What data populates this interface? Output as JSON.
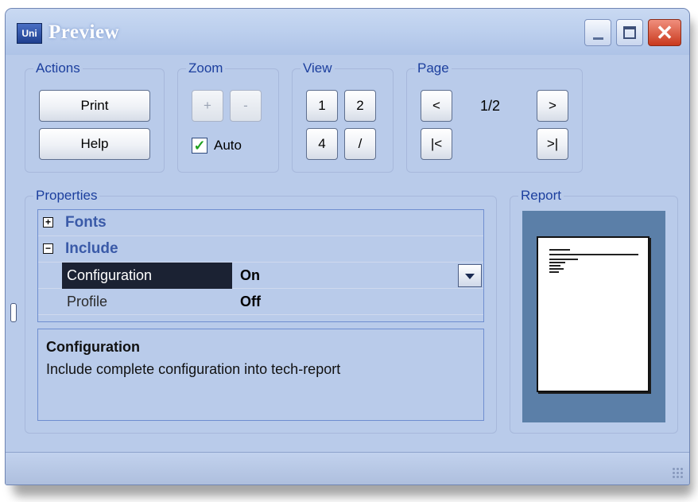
{
  "window": {
    "title": "Preview",
    "app_icon_text": "Uni"
  },
  "actions": {
    "legend": "Actions",
    "print_label": "Print",
    "help_label": "Help"
  },
  "zoom": {
    "legend": "Zoom",
    "zoom_in_label": "+",
    "zoom_out_label": "-",
    "auto_label": "Auto",
    "auto_checked": true
  },
  "view": {
    "legend": "View",
    "one_label": "1",
    "two_label": "2",
    "four_label": "4",
    "custom_label": "/"
  },
  "page": {
    "legend": "Page",
    "prev_label": "<",
    "next_label": ">",
    "first_label": "|<",
    "last_label": ">|",
    "indicator": "1/2"
  },
  "properties": {
    "legend": "Properties",
    "categories": [
      {
        "label": "Fonts",
        "expander": "+"
      },
      {
        "label": "Include",
        "expander": "−"
      }
    ],
    "rows": [
      {
        "name": "Configuration",
        "value": "On",
        "selected": true
      },
      {
        "name": "Profile",
        "value": "Off",
        "selected": false
      }
    ],
    "description": {
      "title": "Configuration",
      "text": "Include complete configuration into tech-report"
    }
  },
  "report": {
    "legend": "Report"
  },
  "colors": {
    "window_bg": "#b9cbea",
    "legend_text": "#1c3f9e",
    "selected_row": "#1b2233",
    "report_bg": "#5b7fa8",
    "close_button": "#c9391d"
  }
}
